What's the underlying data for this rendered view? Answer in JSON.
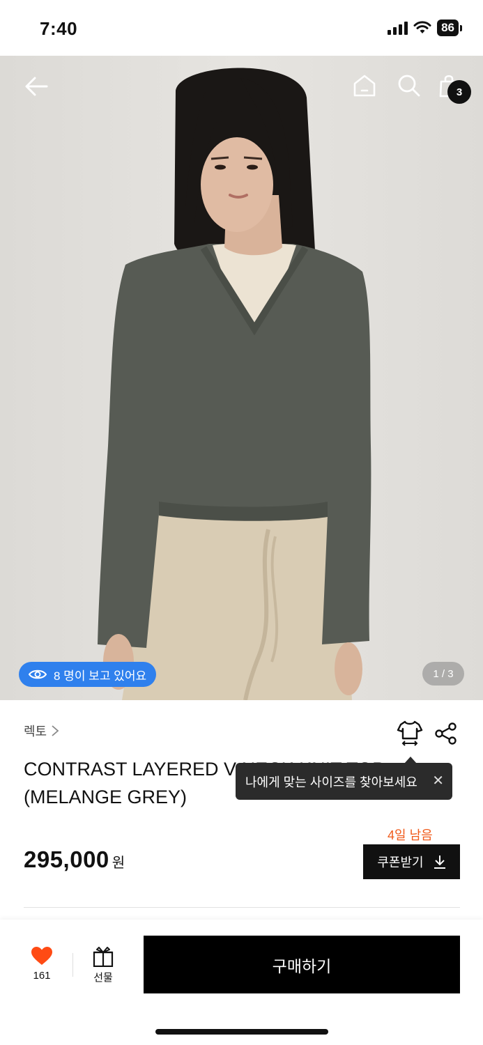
{
  "status_bar": {
    "time": "7:40",
    "battery": "86"
  },
  "top_nav": {
    "cart_count": "3"
  },
  "hero": {
    "viewers_text": "8 명이 보고 있어요",
    "pager": "1 / 3"
  },
  "product": {
    "brand": "렉토",
    "title_line1": "CONTRAST LAYERED V-NECK KNIT TOP",
    "title_line2": "(MELANGE GREY)",
    "days_left": "4일 남음",
    "price": "295,000",
    "currency": "원"
  },
  "tooltip": {
    "text": "나에게 맞는 사이즈를 찾아보세요"
  },
  "coupon": {
    "label": "쿠폰받기"
  },
  "bottom_bar": {
    "like_count": "161",
    "gift_label": "선물",
    "buy_label": "구매하기"
  },
  "colors": {
    "accent_orange": "#f05a1a",
    "badge_blue": "#2f80ed",
    "heart": "#ff4b14",
    "black": "#000000"
  },
  "icons": [
    "back-arrow-icon",
    "home-icon",
    "search-icon",
    "bag-icon",
    "eye-icon",
    "chevron-right-icon",
    "size-fit-icon",
    "share-icon",
    "close-icon",
    "download-icon",
    "heart-icon",
    "gift-icon"
  ]
}
